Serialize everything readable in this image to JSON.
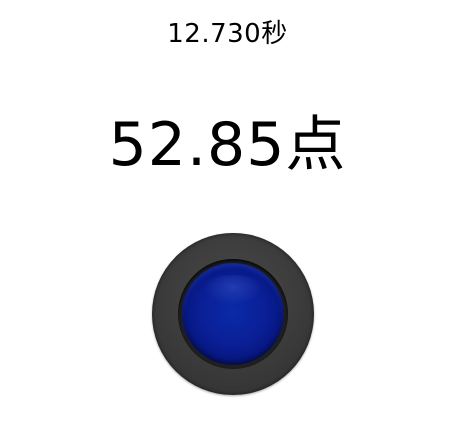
{
  "timer": {
    "text": "12.730秒"
  },
  "score": {
    "text": "52.85点"
  },
  "button": {
    "icon": "round-push-button",
    "base_color": "#3b3b3b",
    "cap_color": "#0a1f96"
  }
}
